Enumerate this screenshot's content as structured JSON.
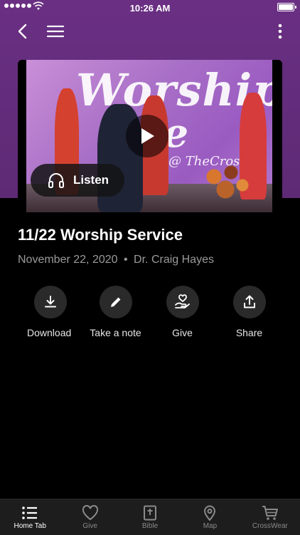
{
  "status_bar": {
    "time": "10:26 AM"
  },
  "nav": {
    "back_icon": "chevron-left-icon",
    "menu_icon": "hamburger-icon",
    "more_icon": "more-vertical-icon"
  },
  "video": {
    "art_title_line1": "Worship",
    "art_title_line2": "ve",
    "art_tag": "@ TheCross",
    "listen_label": "Listen"
  },
  "sermon": {
    "title": "11/22 Worship Service",
    "date": "November 22, 2020",
    "separator": "•",
    "speaker": "Dr. Craig Hayes"
  },
  "actions": [
    {
      "label": "Download",
      "icon": "download-icon"
    },
    {
      "label": "Take a note",
      "icon": "pencil-icon"
    },
    {
      "label": "Give",
      "icon": "heart-hand-icon"
    },
    {
      "label": "Share",
      "icon": "share-icon"
    }
  ],
  "tabbar": {
    "items": [
      {
        "label": "Home Tab",
        "icon": "list-icon",
        "active": true
      },
      {
        "label": "Give",
        "icon": "heart-icon",
        "active": false
      },
      {
        "label": "Bible",
        "icon": "bible-icon",
        "active": false
      },
      {
        "label": "Map",
        "icon": "map-pin-icon",
        "active": false
      },
      {
        "label": "CrossWear",
        "icon": "cart-icon",
        "active": false
      }
    ]
  },
  "colors": {
    "header_purple": "#6a2f83",
    "background": "#000000",
    "action_circle": "#2a2a2a",
    "tabbar": "#1d1d1d",
    "muted_text": "#9a9a9a"
  }
}
